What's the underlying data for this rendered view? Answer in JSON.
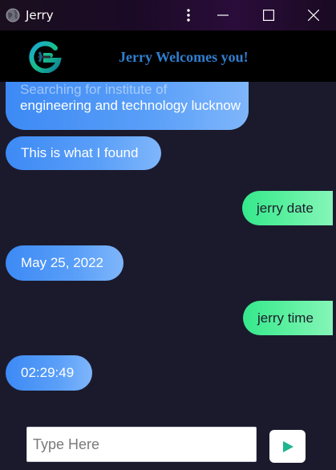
{
  "window": {
    "title": "Jerry"
  },
  "header": {
    "welcome_text": "Jerry Welcomes you!"
  },
  "chat": {
    "messages": [
      {
        "sender": "bot",
        "text_faded": "Searching for institute of",
        "text": "engineering and technology lucknow"
      },
      {
        "sender": "bot",
        "text": "This is what I found"
      },
      {
        "sender": "user",
        "text": "jerry date"
      },
      {
        "sender": "bot",
        "text": "May 25, 2022"
      },
      {
        "sender": "user",
        "text": "jerry time"
      },
      {
        "sender": "bot",
        "text": "02:29:49"
      }
    ]
  },
  "footer": {
    "input_placeholder": "Type Here",
    "input_value": ""
  },
  "colors": {
    "bot_bubble": "#3d8af5",
    "user_bubble": "#36e88c",
    "background": "#1b1a2c",
    "header": "#000000",
    "welcome_text": "#2f7fcf",
    "send_icon": "#1fb58f"
  },
  "icons": {
    "app": "globe-icon",
    "menu": "kebab-menu-icon",
    "minimize": "minimize-icon",
    "maximize": "maximize-icon",
    "close": "close-icon",
    "logo": "g-logo-icon",
    "send": "send-icon"
  }
}
